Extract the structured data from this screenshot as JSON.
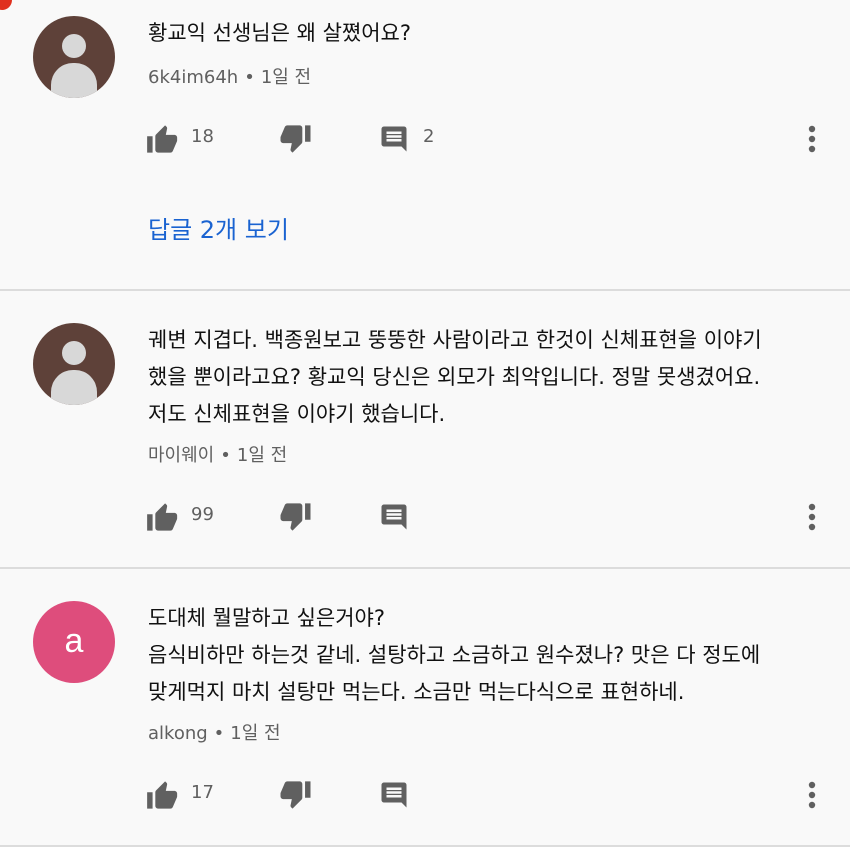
{
  "comments": [
    {
      "avatar_type": "default",
      "text": "황교익 선생님은 왜 살쪘어요?",
      "author": "6k4im64h",
      "separator": "•",
      "time": "1일 전",
      "likes": "18",
      "replies": "2",
      "view_replies_label": "답글 2개 보기"
    },
    {
      "avatar_type": "default",
      "text": "궤변 지겹다. 백종원보고 뚱뚱한 사람이라고 한것이 신체표현을 이야기\n했을 뿐이라고요? 황교익 당신은 외모가 최악입니다. 정말 못생겼어요.\n저도 신체표현을 이야기 했습니다.",
      "author": "마이웨이",
      "separator": "•",
      "time": "1일 전",
      "likes": "99"
    },
    {
      "avatar_type": "letter",
      "avatar_letter": "a",
      "text": "도대체 뭘말하고 싶은거야?\n음식비하만 하는것 같네. 설탕하고 소금하고 원수졌나? 맛은 다 정도에\n맞게먹지 마치 설탕만 먹는다. 소금만 먹는다식으로 표현하네.",
      "author": "alkong",
      "separator": "•",
      "time": "1일 전",
      "likes": "17"
    }
  ],
  "icons": {
    "like": "thumb-up-icon",
    "dislike": "thumb-down-icon",
    "reply": "comment-icon",
    "more": "more-vertical-icon"
  },
  "colors": {
    "accent_link": "#1a63d1",
    "avatar_default_bg": "#5e4139",
    "avatar_letter_bg": "#de4d7c",
    "icon": "#606060"
  }
}
